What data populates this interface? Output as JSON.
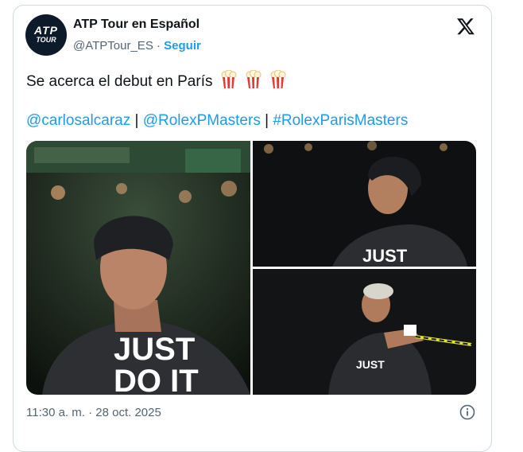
{
  "author": {
    "name": "ATP Tour en Español",
    "handle": "@ATPTour_ES",
    "separator": "·",
    "follow_label": "Seguir",
    "avatar_text": "ATP",
    "avatar_subtext": "TOUR"
  },
  "header": {
    "platform_icon": "x-logo-icon"
  },
  "tweet": {
    "text": "Se acerca el debut en París",
    "emoji_icons": [
      "popcorn-icon",
      "popcorn-icon",
      "popcorn-icon"
    ],
    "mentions": [
      {
        "label": "@carlosalcaraz"
      },
      {
        "label": "@RolexPMasters"
      },
      {
        "label": "#RolexParisMasters"
      }
    ],
    "mention_separator": "|"
  },
  "media": {
    "photos": [
      {
        "shirt_text": "JUST",
        "shirt_text2": "DO IT"
      },
      {
        "shirt_text": "JUST"
      },
      {
        "shirt_text": "JUST"
      }
    ]
  },
  "footer": {
    "timestamp": "11:30 a. m. · 28 oct. 2025",
    "info_icon": "info-icon"
  },
  "colors": {
    "accent": "#1d9bf0",
    "text": "#0f1419",
    "muted": "#536471",
    "border": "#cfd9de"
  }
}
